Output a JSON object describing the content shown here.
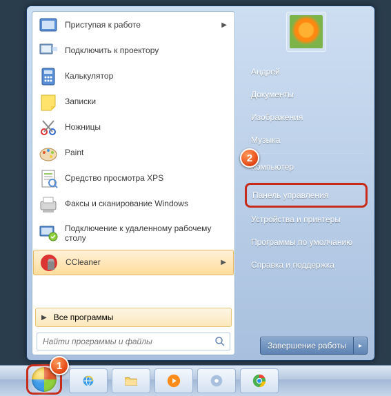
{
  "programs": [
    {
      "label": "Приступая к работе",
      "icon": "getting-started",
      "hasArrow": true
    },
    {
      "label": "Подключить к проектору",
      "icon": "projector"
    },
    {
      "label": "Калькулятор",
      "icon": "calculator"
    },
    {
      "label": "Записки",
      "icon": "sticky-notes"
    },
    {
      "label": "Ножницы",
      "icon": "snipping-tool"
    },
    {
      "label": "Paint",
      "icon": "paint"
    },
    {
      "label": "Средство просмотра XPS",
      "icon": "xps-viewer"
    },
    {
      "label": "Факсы и сканирование Windows",
      "icon": "fax-scan"
    },
    {
      "label": "Подключение к удаленному рабочему столу",
      "icon": "remote-desktop",
      "tall": true
    },
    {
      "label": "CCleaner",
      "icon": "ccleaner",
      "selected": true,
      "hasArrow": true
    }
  ],
  "allPrograms": "Все программы",
  "search": {
    "placeholder": "Найти программы и файлы"
  },
  "rightItems": [
    {
      "label": "Андрей",
      "sep": false
    },
    {
      "label": "Документы",
      "sep": false
    },
    {
      "label": "Изображения",
      "sep": false
    },
    {
      "label": "Музыка",
      "sep": true
    },
    {
      "label": "Компьютер",
      "sep": true
    },
    {
      "label": "Панель управления",
      "highlight": true
    },
    {
      "label": "Устройства и принтеры",
      "sep": false
    },
    {
      "label": "Программы по умолчанию",
      "sep": false
    },
    {
      "label": "Справка и поддержка",
      "sep": false
    }
  ],
  "shutdown": {
    "label": "Завершение работы"
  },
  "taskbar": {
    "items": [
      "ie",
      "explorer",
      "media-player",
      "app",
      "chrome"
    ]
  },
  "badges": {
    "b1": "1",
    "b2": "2"
  }
}
